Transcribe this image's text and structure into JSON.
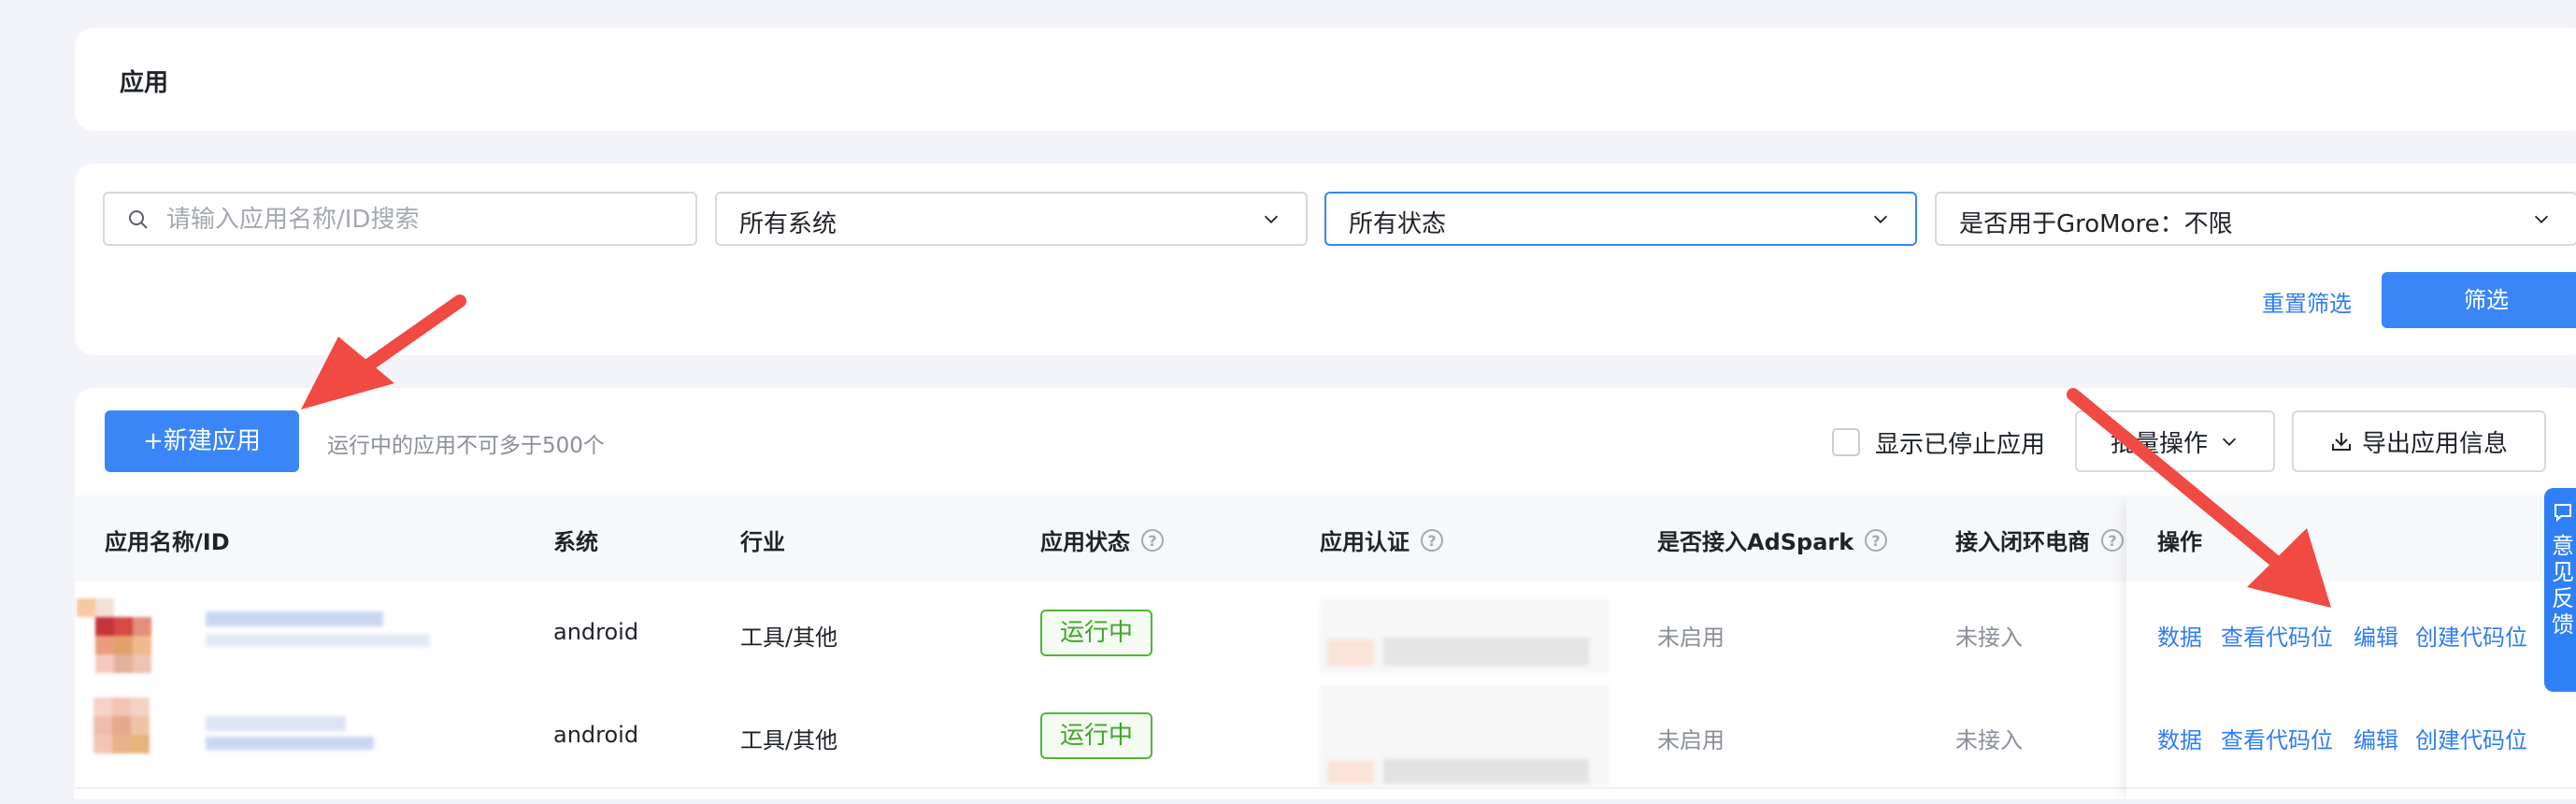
{
  "page_title": "应用",
  "filters": {
    "search_placeholder": "请输入应用名称/ID搜索",
    "system": "所有系统",
    "status": "所有状态",
    "gromore": "是否用于GroMore：不限",
    "reset_label": "重置筛选",
    "filter_label": "筛选"
  },
  "toolbar": {
    "new_app_label": "+新建应用",
    "limit_note": "运行中的应用不可多于500个",
    "show_stopped_label": "显示已停止应用",
    "batch_label": "批量操作",
    "export_label": "导出应用信息"
  },
  "table": {
    "columns": [
      "应用名称/ID",
      "系统",
      "行业",
      "应用状态",
      "应用认证",
      "是否接入AdSpark",
      "接入闭环电商",
      "操作"
    ],
    "rows": [
      {
        "system": "android",
        "industry": "工具/其他",
        "status": "运行中",
        "adspark": "未启用",
        "ecommerce": "未接入"
      },
      {
        "system": "android",
        "industry": "工具/其他",
        "status": "运行中",
        "adspark": "未启用",
        "ecommerce": "未接入"
      }
    ],
    "actions": [
      "数据",
      "查看代码位",
      "编辑",
      "创建代码位"
    ]
  },
  "feedback": {
    "label": "意见反馈"
  },
  "colors": {
    "primary": "#3a86f6",
    "success": "#40a42c",
    "annotation_arrow": "#f04a42"
  },
  "icons": [
    "search-icon",
    "chevron-down-icon",
    "help-icon",
    "download-icon",
    "feedback-icon"
  ]
}
